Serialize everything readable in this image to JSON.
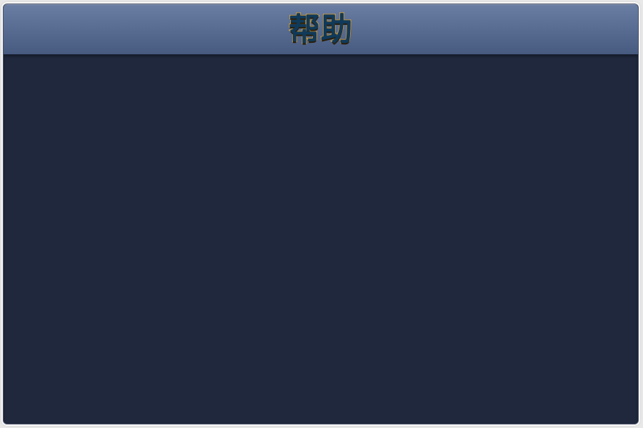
{
  "dialog": {
    "title": "帮助"
  },
  "colors": {
    "header_gradient_top": "#6a7ea4",
    "header_gradient_bottom": "#475a80",
    "content_background": "#1f283d",
    "title_fill": "#103a5a",
    "title_outline": "#e0b45a"
  }
}
